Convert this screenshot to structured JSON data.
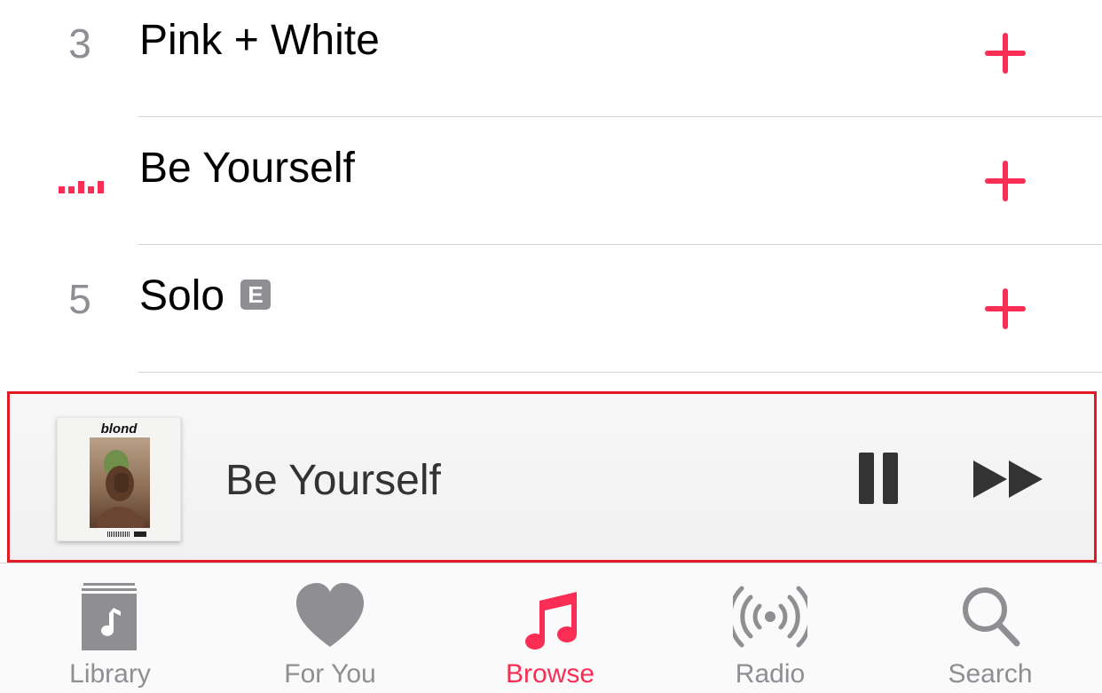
{
  "tracks": [
    {
      "number": "3",
      "title": "Pink + White",
      "explicit": false,
      "playing": false
    },
    {
      "number": "",
      "title": "Be Yourself",
      "explicit": false,
      "playing": true
    },
    {
      "number": "5",
      "title": "Solo",
      "explicit": true,
      "explicit_label": "E",
      "playing": false
    }
  ],
  "now_playing": {
    "title": "Be Yourself",
    "album_art_title": "blond",
    "controls": [
      "pause-icon",
      "fast-forward-icon"
    ]
  },
  "tabs": [
    {
      "label": "Library",
      "icon": "library-icon",
      "active": false
    },
    {
      "label": "For You",
      "icon": "heart-icon",
      "active": false
    },
    {
      "label": "Browse",
      "icon": "music-note-icon",
      "active": true
    },
    {
      "label": "Radio",
      "icon": "radio-broadcast-icon",
      "active": false
    },
    {
      "label": "Search",
      "icon": "search-icon",
      "active": false
    }
  ],
  "colors": {
    "accent": "#fa2d55",
    "inactive": "#8e8e93",
    "highlight_border": "#e01b24"
  }
}
